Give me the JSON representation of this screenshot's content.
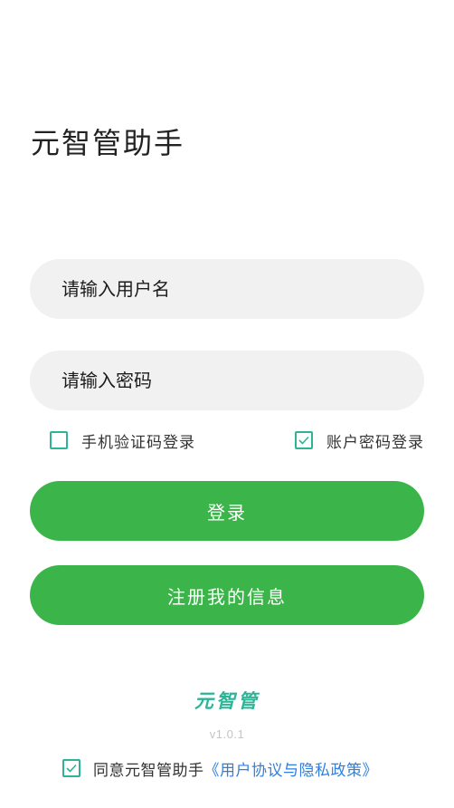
{
  "app": {
    "title": "元智管助手"
  },
  "form": {
    "username_placeholder": "请输入用户名",
    "password_placeholder": "请输入密码"
  },
  "login_mode": {
    "sms_label": "手机验证码登录",
    "sms_checked": false,
    "password_label": "账户密码登录",
    "password_checked": true
  },
  "buttons": {
    "login_label": "登录",
    "register_label": "注册我的信息"
  },
  "footer": {
    "brand": "元智管",
    "version": "v1.0.1",
    "agree_text": "同意元智管助手",
    "agree_link": "《用户协议与隐私政策》",
    "agree_checked": true
  },
  "colors": {
    "primary_button": "#3bb54a",
    "checkbox_accent": "#2bb596",
    "link": "#2f7fe0",
    "field_background": "#f1f1f1"
  }
}
